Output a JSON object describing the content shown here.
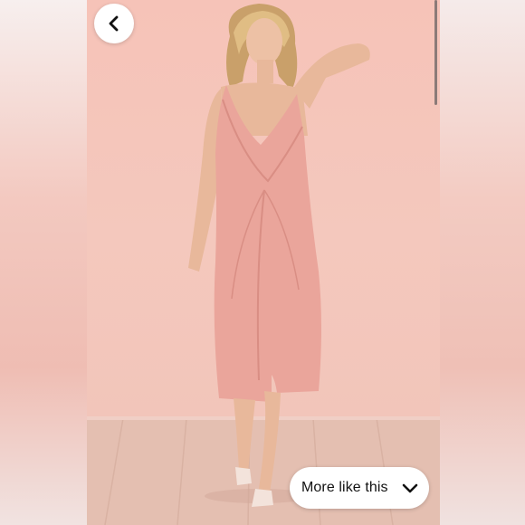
{
  "viewer": {
    "accent_background": "#f4c8bd",
    "back_icon": "chevron-left-icon",
    "more_button": {
      "label": "More like this",
      "icon": "chevron-down-icon"
    }
  }
}
